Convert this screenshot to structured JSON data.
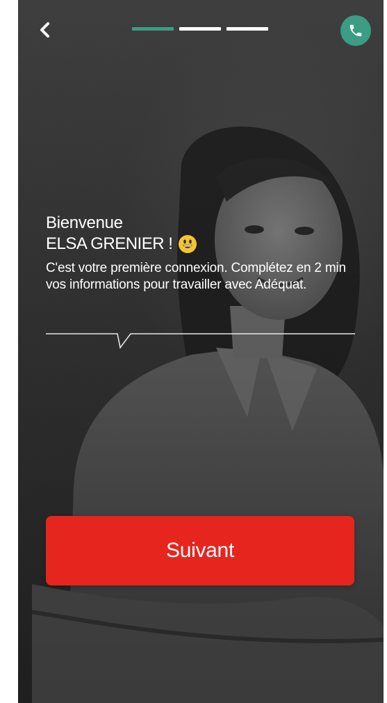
{
  "header": {
    "back_icon": "chevron-left-icon",
    "phone_icon": "phone-icon",
    "progress": {
      "total_steps": 3,
      "current_step": 1
    },
    "accent_color": "#3a9d84"
  },
  "welcome": {
    "greeting": "Bienvenue",
    "username": "ELSA GRENIER !",
    "emoji": "grinning-face-icon",
    "message": "C'est votre première connexion. Complétez en 2 min vos informations pour travailler avec Adéquat."
  },
  "actions": {
    "next_label": "Suivant",
    "next_color": "#e5251e"
  }
}
